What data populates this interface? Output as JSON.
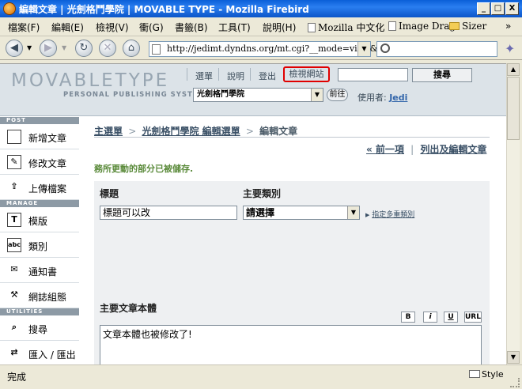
{
  "window": {
    "title": "編輯文章 | 光劍格鬥學院 | MOVABLE TYPE - Mozilla Firebird",
    "min_glyph": "_",
    "max_glyph": "□",
    "close_glyph": "X"
  },
  "menu": {
    "items": [
      "檔案(F)",
      "編輯(E)",
      "檢視(V)",
      "衝(G)",
      "書籤(B)",
      "工具(T)",
      "說明(H)"
    ],
    "bookmarks": [
      "Mozilla 中文化",
      "Image Drag",
      "Sizer"
    ],
    "overflow": "»"
  },
  "navbar": {
    "url": "http://jedimt.dyndns.org/mt.cgi?__mode=view&_ty"
  },
  "mt": {
    "logo": "MOVABLETYPE",
    "logo_sub": "PERSONAL PUBLISHING SYSTEM",
    "links": [
      "選單",
      "說明",
      "登出"
    ],
    "view_site": "檢視網站",
    "search_button": "搜尋",
    "blog_select": "光劍格鬥學院",
    "go_button": "前往",
    "user_label": "使用者:",
    "user_name": "Jedi"
  },
  "sidebar": {
    "sections": {
      "post": "POST",
      "manage": "MANAGE",
      "utilities": "UTILITIES"
    },
    "post_items": [
      "新增文章",
      "修改文章",
      "上傳檔案"
    ],
    "manage_items": [
      "模版",
      "類別",
      "通知書",
      "網誌組態"
    ],
    "utility_items": [
      "搜尋",
      "匯入 / 匯出"
    ]
  },
  "main": {
    "breadcrumb": [
      "主選單",
      "光劍格鬥學院 編輯選單",
      "編輯文章"
    ],
    "breadcrumb_sep": ">",
    "prev": "« 前一項",
    "list": "列出及編輯文章",
    "pager_sep": "|",
    "saved_message": "務所更動的部分已被儲存.",
    "title_label": "標題",
    "title_value": "標題可以改",
    "category_label": "主要類別",
    "category_value": "請選擇",
    "multi_category": "指定多重類別",
    "body_label": "主要文章本體",
    "format_buttons": [
      "B",
      "i",
      "U",
      "URL"
    ],
    "body_value": "文章本體也被修改了!"
  },
  "status": {
    "text": "完成",
    "style": "Style"
  }
}
